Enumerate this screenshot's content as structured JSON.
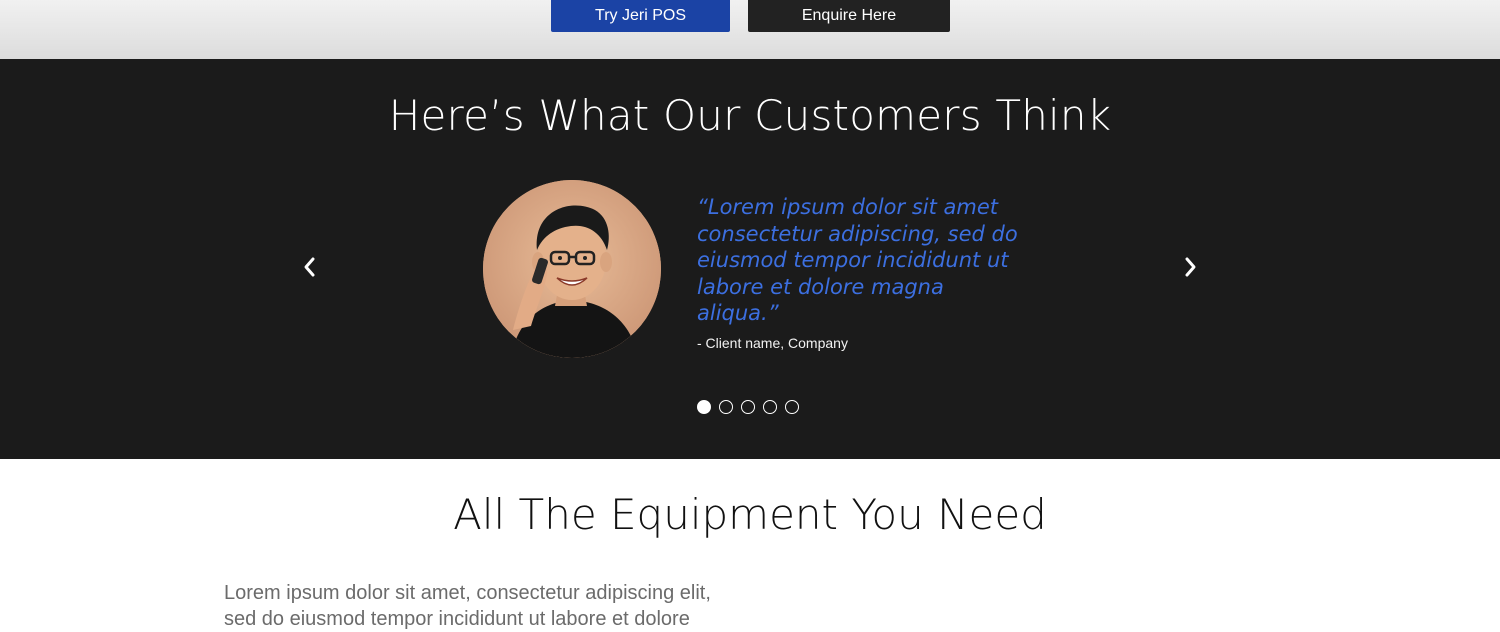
{
  "cta": {
    "try_label": "Try Jeri POS",
    "enquire_label": "Enquire Here",
    "try_color": "#1b43a5",
    "enquire_color": "#222222"
  },
  "testimonials": {
    "title": "Here’s What Our Customers Think",
    "quote": "“Lorem ipsum dolor sit amet consectetur adipiscing, sed do eiusmod tempor incididunt ut labore et dolore magna aliqua.”",
    "client": "- Client name, Company",
    "quote_color": "#3c6fe0",
    "background": "#1b1b1b",
    "prev_icon": "chevron-left-icon",
    "next_icon": "chevron-right-icon",
    "slide_count": 5,
    "active_slide": 1
  },
  "equipment": {
    "title": "All The Equipment You Need",
    "body": "Lorem ipsum dolor sit amet, consectetur adipiscing elit, sed do eiusmod tempor incididunt ut labore et dolore"
  }
}
